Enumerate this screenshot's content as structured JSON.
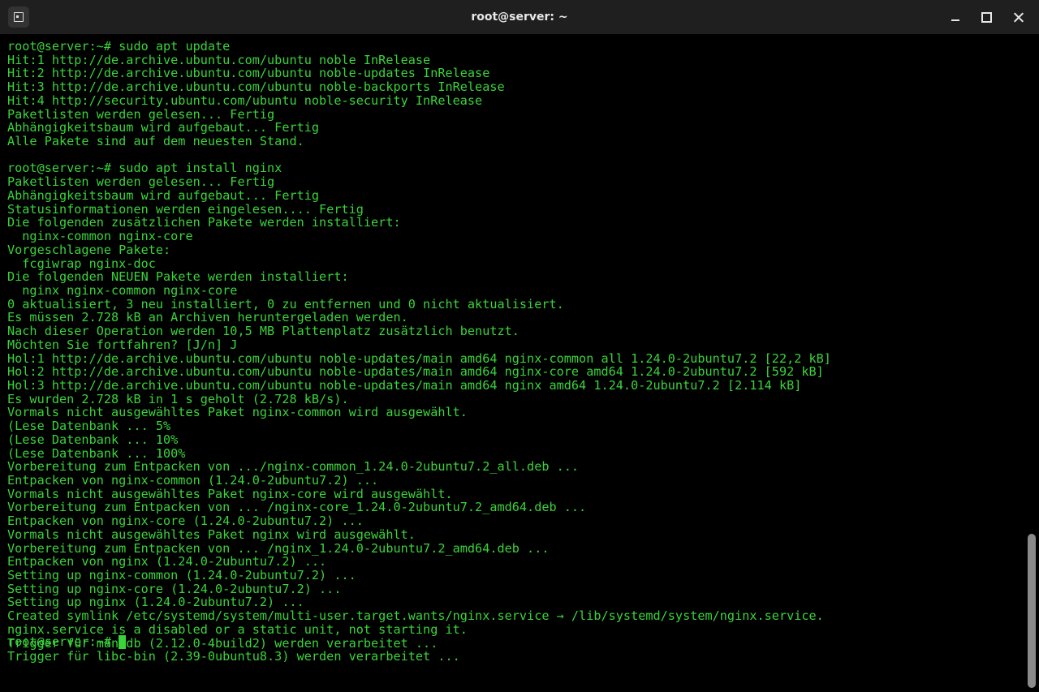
{
  "window": {
    "title": "root@server: ~"
  },
  "icons": {
    "new_tab": "new-tab-icon",
    "minimize": "minimize-icon",
    "maximize": "maximize-icon",
    "close": "close-icon"
  },
  "colors": {
    "terminal_text": "#3ad43a",
    "terminal_bg": "#000000",
    "titlebar_bg": "#1f1f1f"
  },
  "terminal": {
    "lines": [
      "root@server:~# sudo apt update",
      "Hit:1 http://de.archive.ubuntu.com/ubuntu noble InRelease",
      "Hit:2 http://de.archive.ubuntu.com/ubuntu noble-updates InRelease",
      "Hit:3 http://de.archive.ubuntu.com/ubuntu noble-backports InRelease",
      "Hit:4 http://security.ubuntu.com/ubuntu noble-security InRelease",
      "Paketlisten werden gelesen... Fertig",
      "Abhängigkeitsbaum wird aufgebaut... Fertig",
      "Alle Pakete sind auf dem neuesten Stand.",
      "",
      "root@server:~# sudo apt install nginx",
      "Paketlisten werden gelesen... Fertig",
      "Abhängigkeitsbaum wird aufgebaut... Fertig",
      "Statusinformationen werden eingelesen.... Fertig",
      "Die folgenden zusätzlichen Pakete werden installiert:",
      "  nginx-common nginx-core",
      "Vorgeschlagene Pakete:",
      "  fcgiwrap nginx-doc",
      "Die folgenden NEUEN Pakete werden installiert:",
      "  nginx nginx-common nginx-core",
      "0 aktualisiert, 3 neu installiert, 0 zu entfernen und 0 nicht aktualisiert.",
      "Es müssen 2.728 kB an Archiven heruntergeladen werden.",
      "Nach dieser Operation werden 10,5 MB Plattenplatz zusätzlich benutzt.",
      "Möchten Sie fortfahren? [J/n] J",
      "Hol:1 http://de.archive.ubuntu.com/ubuntu noble-updates/main amd64 nginx-common all 1.24.0-2ubuntu7.2 [22,2 kB]",
      "Hol:2 http://de.archive.ubuntu.com/ubuntu noble-updates/main amd64 nginx-core amd64 1.24.0-2ubuntu7.2 [592 kB]",
      "Hol:3 http://de.archive.ubuntu.com/ubuntu noble-updates/main amd64 nginx amd64 1.24.0-2ubuntu7.2 [2.114 kB]",
      "Es wurden 2.728 kB in 1 s geholt (2.728 kB/s).",
      "Vormals nicht ausgewähltes Paket nginx-common wird ausgewählt.",
      "(Lese Datenbank ... 5%",
      "(Lese Datenbank ... 10%",
      "(Lese Datenbank ... 100%",
      "Vorbereitung zum Entpacken von .../nginx-common_1.24.0-2ubuntu7.2_all.deb ...",
      "Entpacken von nginx-common (1.24.0-2ubuntu7.2) ...",
      "Vormals nicht ausgewähltes Paket nginx-core wird ausgewählt.",
      "Vorbereitung zum Entpacken von ... /nginx-core_1.24.0-2ubuntu7.2_amd64.deb ...",
      "Entpacken von nginx-core (1.24.0-2ubuntu7.2) ...",
      "Vormals nicht ausgewähltes Paket nginx wird ausgewählt.",
      "Vorbereitung zum Entpacken von ... /nginx_1.24.0-2ubuntu7.2_amd64.deb ...",
      "Entpacken von nginx (1.24.0-2ubuntu7.2) ...",
      "Setting up nginx-common (1.24.0-2ubuntu7.2) ...",
      "Setting up nginx-core (1.24.0-2ubuntu7.2) ...",
      "Setting up nginx (1.24.0-2ubuntu7.2) ...",
      "Created symlink /etc/systemd/system/multi-user.target.wants/nginx.service → /lib/systemd/system/nginx.service.",
      "nginx.service is a disabled or a static unit, not starting it.",
      "Trigger für man-db (2.12.0-4build2) werden verarbeitet ...",
      "Trigger für libc-bin (2.39-0ubuntu8.3) werden verarbeitet ..."
    ],
    "prompt": "root@server:~#"
  }
}
